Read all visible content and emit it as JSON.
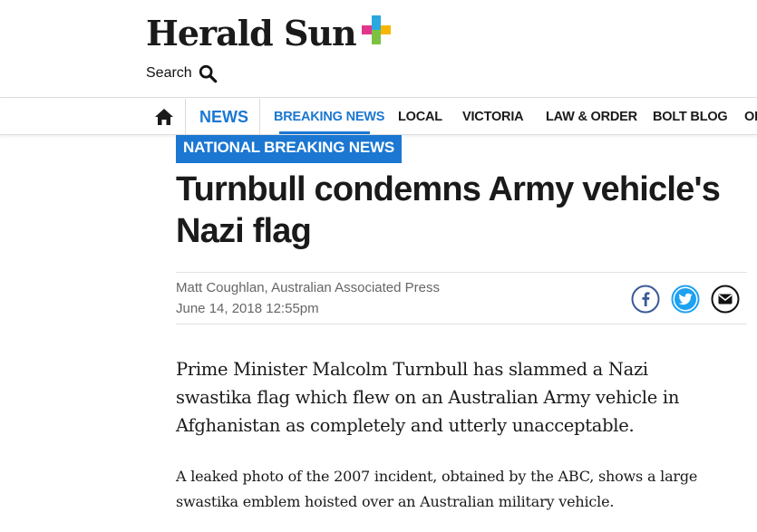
{
  "header": {
    "logo_text": "Herald Sun",
    "search_label": "Search"
  },
  "nav": {
    "section": "NEWS",
    "items": [
      {
        "label": "BREAKING NEWS",
        "active": true
      },
      {
        "label": "LOCAL",
        "active": false
      },
      {
        "label": "VICTORIA",
        "active": false
      },
      {
        "label": "LAW & ORDER",
        "active": false
      },
      {
        "label": "BOLT BLOG",
        "active": false
      },
      {
        "label": "OP",
        "active": false
      }
    ]
  },
  "article": {
    "kicker": "NATIONAL BREAKING NEWS",
    "headline": "Turnbull condemns Army vehicle's Nazi flag",
    "author": "Matt Coughlan, Australian Associated Press",
    "date": "June 14, 2018 12:55pm",
    "lead": "Prime Minister Malcolm Turnbull has slammed a Nazi swastika flag which flew on an Australian Army vehicle in Afghanistan as completely and utterly unacceptable.",
    "paragraph": "A leaked photo of the 2007 incident, obtained by the ABC, shows a large swastika emblem hoisted over an Australian military vehicle."
  },
  "share": {
    "icons": [
      "facebook-icon",
      "twitter-icon",
      "email-icon"
    ]
  },
  "colors": {
    "accent": "#1b77d2",
    "text": "#1a1a1a",
    "meta": "#666666"
  }
}
